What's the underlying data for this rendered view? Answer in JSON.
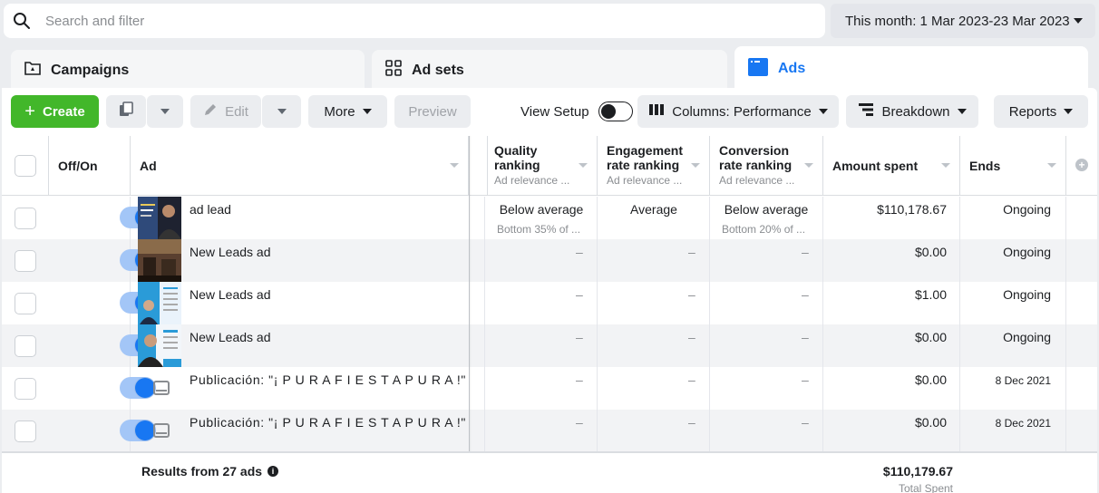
{
  "search": {
    "placeholder": "Search and filter"
  },
  "date_range": {
    "label": "This month: 1 Mar 2023-23 Mar 2023"
  },
  "tabs": [
    {
      "label": "Campaigns"
    },
    {
      "label": "Ad sets"
    },
    {
      "label": "Ads"
    }
  ],
  "toolbar": {
    "create_label": "Create",
    "edit_label": "Edit",
    "more_label": "More",
    "preview_label": "Preview",
    "view_setup_label": "View Setup",
    "columns_label": "Columns: Performance",
    "breakdown_label": "Breakdown",
    "reports_label": "Reports"
  },
  "table": {
    "headers": {
      "offon": "Off/On",
      "ad": "Ad",
      "quality": "Quality ranking",
      "quality_sub": "Ad relevance ...",
      "engagement": "Engagement rate ranking",
      "engagement_sub": "Ad relevance ...",
      "conversion": "Conversion rate ranking",
      "conversion_sub": "Ad relevance ...",
      "amount": "Amount spent",
      "ends": "Ends"
    },
    "rows": [
      {
        "name": "ad lead",
        "quality": "Below average",
        "quality_sub": "Bottom 35% of ...",
        "engagement": "Average",
        "conversion": "Below average",
        "conversion_sub": "Bottom 20% of ...",
        "amount": "$110,178.67",
        "ends": "Ongoing"
      },
      {
        "name": "New Leads ad",
        "quality": "–",
        "engagement": "–",
        "conversion": "–",
        "amount": "$0.00",
        "ends": "Ongoing"
      },
      {
        "name": "New Leads ad",
        "quality": "–",
        "engagement": "–",
        "conversion": "–",
        "amount": "$1.00",
        "ends": "Ongoing"
      },
      {
        "name": "New Leads ad",
        "quality": "–",
        "engagement": "–",
        "conversion": "–",
        "amount": "$0.00",
        "ends": "Ongoing"
      },
      {
        "name": "Publicación: \"¡ P U R A F I E S T A P U R A !\"",
        "quality": "–",
        "engagement": "–",
        "conversion": "–",
        "amount": "$0.00",
        "ends": "8 Dec 2021"
      },
      {
        "name": "Publicación: \"¡ P U R A F I E S T A P U R A !\"",
        "quality": "–",
        "engagement": "–",
        "conversion": "–",
        "amount": "$0.00",
        "ends": "8 Dec 2021"
      }
    ],
    "summary": {
      "label": "Results from 27 ads",
      "total": "$110,179.67",
      "total_sub": "Total Spent"
    }
  },
  "colors": {
    "accent": "#1877f2",
    "create": "#42b72a"
  }
}
